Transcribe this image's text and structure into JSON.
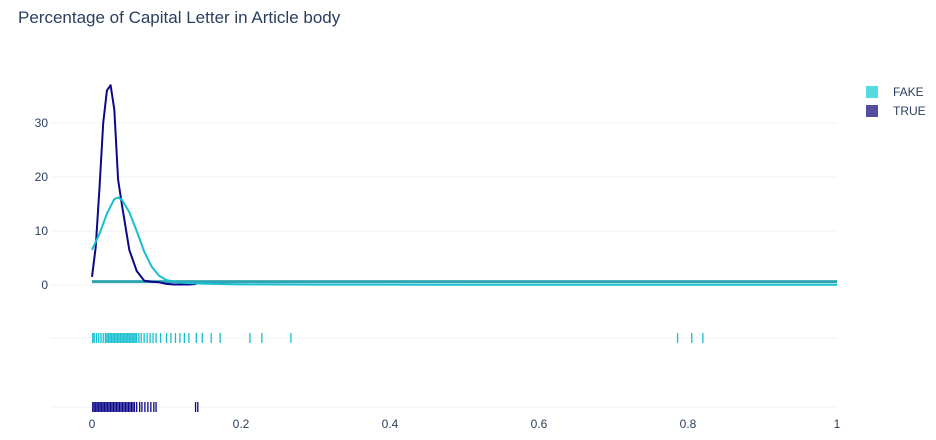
{
  "chart_data": {
    "type": "distplot",
    "title": "Percentage of Capital Letter in Article body",
    "xlabel": "",
    "ylabel": "",
    "xlim": [
      0,
      1
    ],
    "ylim": [
      -1.5,
      38
    ],
    "x_ticks": [
      "0",
      "0.2",
      "0.4",
      "0.6",
      "0.8",
      "1"
    ],
    "y_ticks": [
      "0",
      "10",
      "20",
      "30"
    ],
    "legend_position": "top-right",
    "series": [
      {
        "name": "FAKE",
        "color": "#17becf",
        "legend_color": "#4dd8e0",
        "kde": {
          "x": [
            0,
            0.01,
            0.02,
            0.03,
            0.035,
            0.04,
            0.05,
            0.06,
            0.07,
            0.08,
            0.09,
            0.1,
            0.12,
            0.15,
            0.2,
            0.3,
            0.5,
            0.8,
            1
          ],
          "y": [
            6.5,
            9.5,
            13.2,
            15.9,
            16.2,
            15.8,
            13.5,
            10,
            6.2,
            3.4,
            1.7,
            0.9,
            0.4,
            0.25,
            0.12,
            0.08,
            0.05,
            0.05,
            0.05
          ]
        },
        "histogram_band": [
          0.5,
          0.9
        ],
        "rug": [
          0.001,
          0.003,
          0.006,
          0.009,
          0.012,
          0.015,
          0.018,
          0.02,
          0.022,
          0.024,
          0.026,
          0.028,
          0.03,
          0.032,
          0.034,
          0.036,
          0.038,
          0.04,
          0.042,
          0.044,
          0.046,
          0.048,
          0.05,
          0.052,
          0.054,
          0.056,
          0.058,
          0.06,
          0.063,
          0.066,
          0.07,
          0.074,
          0.078,
          0.082,
          0.086,
          0.092,
          0.1,
          0.106,
          0.112,
          0.118,
          0.124,
          0.13,
          0.14,
          0.148,
          0.16,
          0.172,
          0.212,
          0.228,
          0.267,
          0.786,
          0.805,
          0.82
        ]
      },
      {
        "name": "TRUE",
        "color": "#0d0887",
        "legend_color": "#4a4599",
        "kde": {
          "x": [
            0,
            0.005,
            0.01,
            0.015,
            0.02,
            0.025,
            0.03,
            0.035,
            0.04,
            0.045,
            0.05,
            0.06,
            0.07,
            0.08,
            0.09,
            0.1,
            0.11,
            0.12,
            0.13,
            0.14
          ],
          "y": [
            1.5,
            7,
            18,
            30,
            36,
            37,
            32.5,
            19.5,
            15,
            10.8,
            6.5,
            2.6,
            0.8,
            0.6,
            0.5,
            0.2,
            0.1,
            0.1,
            0.1,
            0.2
          ]
        },
        "rug": [
          0.001,
          0.003,
          0.005,
          0.007,
          0.009,
          0.011,
          0.013,
          0.015,
          0.017,
          0.019,
          0.021,
          0.023,
          0.025,
          0.027,
          0.029,
          0.031,
          0.033,
          0.035,
          0.037,
          0.039,
          0.041,
          0.043,
          0.045,
          0.047,
          0.049,
          0.051,
          0.053,
          0.055,
          0.057,
          0.06,
          0.064,
          0.067,
          0.071,
          0.075,
          0.079,
          0.083,
          0.086,
          0.139,
          0.142
        ]
      }
    ]
  }
}
